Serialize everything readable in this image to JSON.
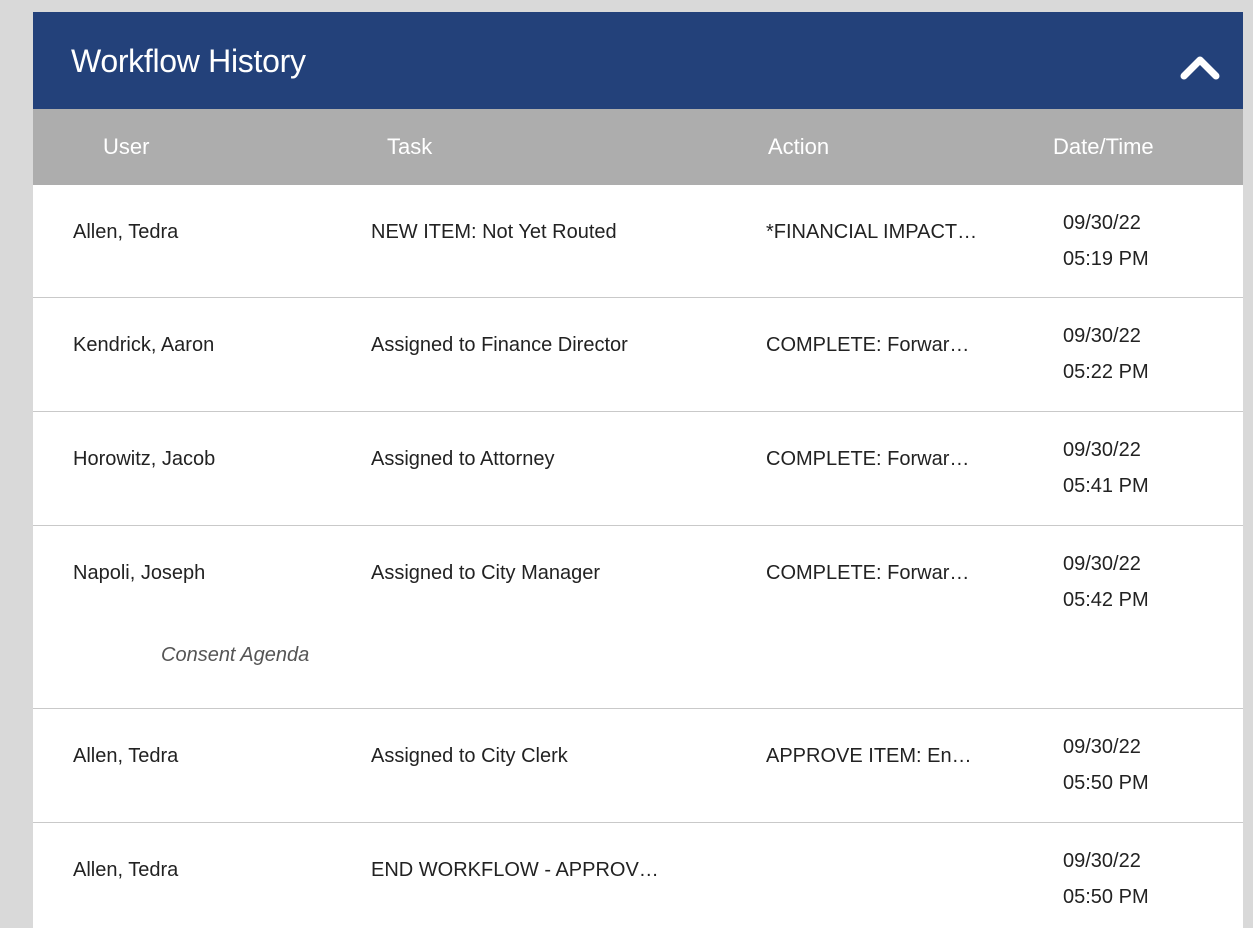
{
  "panel": {
    "title": "Workflow History",
    "collapse_icon": "chevron-up-icon"
  },
  "columns": [
    "User",
    "Task",
    "Action",
    "Date/Time"
  ],
  "rows": [
    {
      "user": "Allen, Tedra",
      "task": "NEW ITEM: Not Yet Routed",
      "action": "*FINANCIAL IMPACT…",
      "date": "09/30/22",
      "time": "05:19 PM",
      "note": ""
    },
    {
      "user": "Kendrick, Aaron",
      "task": "Assigned to Finance Director",
      "action": "COMPLETE: Forwar…",
      "date": "09/30/22",
      "time": "05:22 PM",
      "note": ""
    },
    {
      "user": "Horowitz, Jacob",
      "task": "Assigned to Attorney",
      "action": "COMPLETE: Forwar…",
      "date": "09/30/22",
      "time": "05:41 PM",
      "note": ""
    },
    {
      "user": "Napoli, Joseph",
      "task": "Assigned to City Manager",
      "action": "COMPLETE: Forwar…",
      "date": "09/30/22",
      "time": "05:42 PM",
      "note": "Consent Agenda"
    },
    {
      "user": "Allen, Tedra",
      "task": "Assigned to City Clerk",
      "action": "APPROVE ITEM: En…",
      "date": "09/30/22",
      "time": "05:50 PM",
      "note": ""
    },
    {
      "user": "Allen, Tedra",
      "task": "END WORKFLOW - APPROV…",
      "action": "",
      "date": "09/30/22",
      "time": "05:50 PM",
      "note": ""
    }
  ]
}
